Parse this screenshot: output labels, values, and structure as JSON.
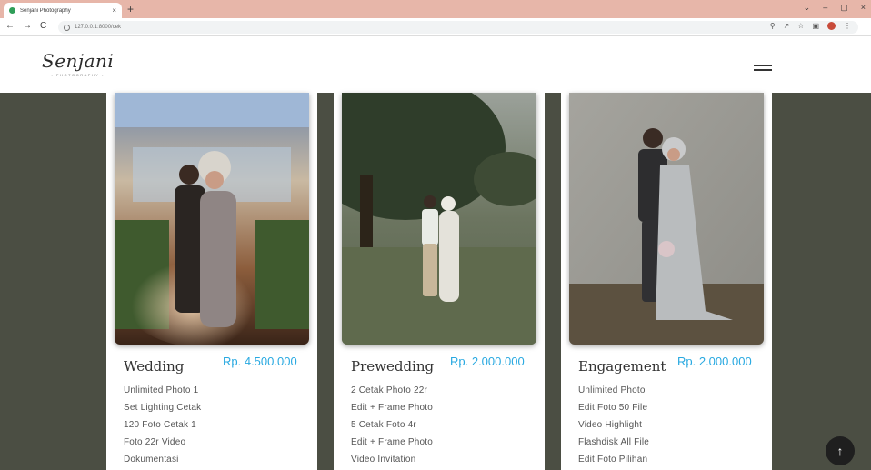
{
  "browser": {
    "tab_title": "Senjani Photography",
    "tab_close": "×",
    "new_tab": "+",
    "url": "127.0.0.1:8000/cek",
    "nav": {
      "back": "←",
      "forward": "→",
      "reload": "C"
    },
    "window_controls": [
      "⌄",
      "–",
      "▢",
      "×"
    ],
    "toolbar_icons": [
      "zoom-icon",
      "share-icon",
      "star-icon",
      "sidebar-icon",
      "profile-avatar",
      "menu-icon"
    ]
  },
  "site": {
    "logo": "Senjani",
    "logo_sub": "- PHOTOGRAPHY -"
  },
  "packages": [
    {
      "title": "Wedding",
      "price": "Rp. 4.500.000",
      "features": [
        "Unlimited Photo 1",
        "Set Lighting Cetak",
        "120 Foto Cetak 1",
        "Foto 22r Video",
        "Dokumentasi"
      ]
    },
    {
      "title": "Prewedding",
      "price": "Rp. 2.000.000",
      "features": [
        "2 Cetak Photo 22r",
        "Edit + Frame Photo",
        "5 Cetak Foto 4r",
        "Edit + Frame Photo",
        "Video Invitation"
      ]
    },
    {
      "title": "Engagement",
      "price": "Rp. 2.000.000",
      "features": [
        "Unlimited Photo",
        "Edit Foto 50 File",
        "Video Highlight",
        "Flashdisk All File",
        "Edit Foto Pilihan"
      ]
    }
  ],
  "colors": {
    "background": "#4b4e43",
    "price": "#29a9e1",
    "tabbar": "#e7b6a9"
  },
  "scroll_top_icon": "arrow-up-icon"
}
